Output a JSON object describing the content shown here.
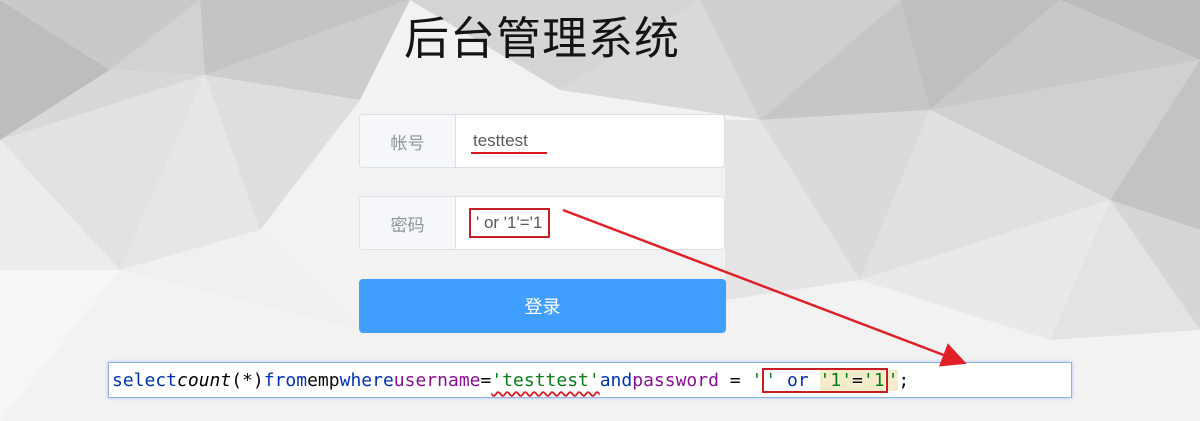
{
  "header": {
    "title": "后台管理系统"
  },
  "form": {
    "username_label": "帐号",
    "username_value": "testtest",
    "password_label": "密码",
    "password_value": "' or '1'='1",
    "login_label": "登录"
  },
  "sql": {
    "kw_select": "select",
    "fn_count": "count",
    "args": "(*)",
    "kw_from": "from",
    "table": "emp",
    "kw_where": "where",
    "col_username": "username",
    "eq1": "=",
    "str_username": "'testtest'",
    "kw_and": "and",
    "col_password": "password",
    "eq2": " = ",
    "str_open": "'",
    "str_close": "'",
    "kw_or": "or",
    "str_one_a": "'1'",
    "eq3": "=",
    "str_one_b": "'1",
    "str_end": "'",
    "semicolon": ";"
  },
  "colors": {
    "button": "#409eff",
    "annotation": "#c81d25",
    "keyword": "#0033b3",
    "string": "#067d17",
    "column": "#871094"
  },
  "icons": [
    "annotation-arrow"
  ]
}
